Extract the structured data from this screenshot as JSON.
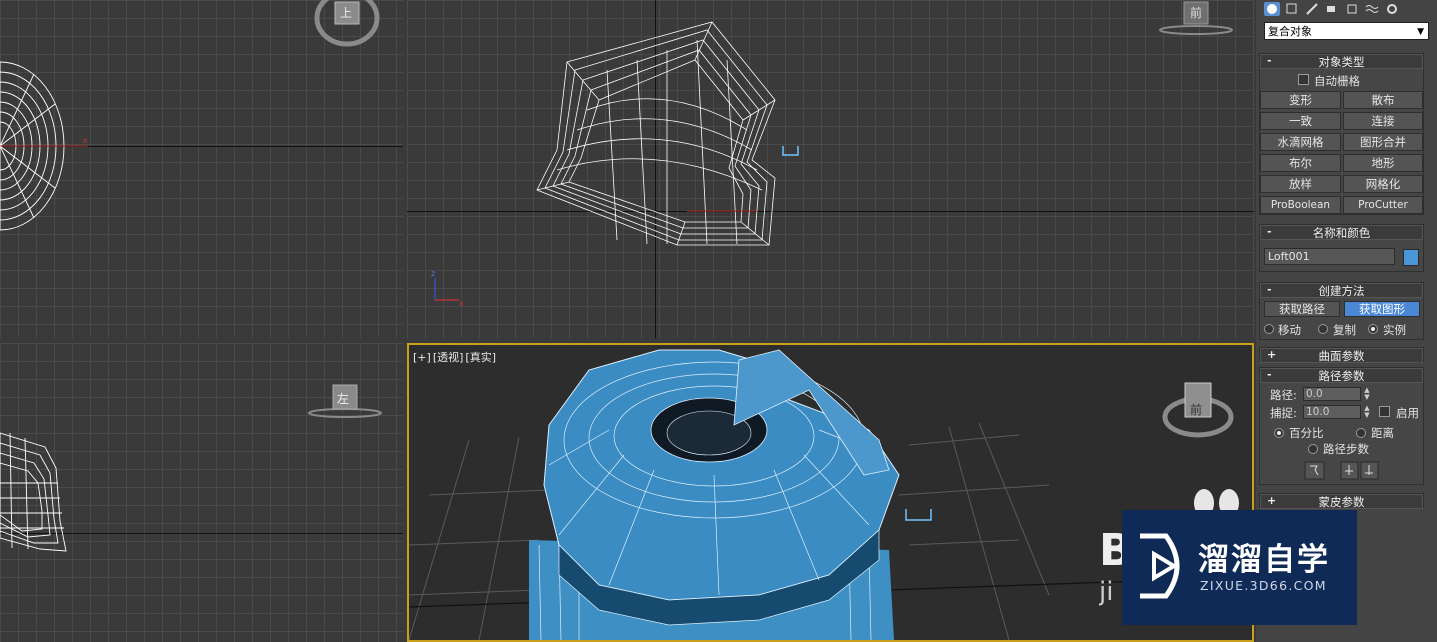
{
  "viewports": {
    "top": {
      "cube_label": "上"
    },
    "front": {
      "cube_label": "前"
    },
    "left": {
      "cube_label": "左"
    },
    "perspective": {
      "label_parts": [
        "[+]",
        "[透视]",
        "[真实]"
      ],
      "cube_label": "前"
    }
  },
  "command_panel": {
    "category_dropdown": "复合对象",
    "object_type": {
      "title": "对象类型",
      "autogrid_label": "自动栅格",
      "buttons": [
        "变形",
        "散布",
        "一致",
        "连接",
        "水滴网格",
        "图形合并",
        "布尔",
        "地形",
        "放样",
        "网格化",
        "ProBoolean",
        "ProCutter"
      ]
    },
    "name_and_color": {
      "title": "名称和颜色",
      "name_value": "Loft001",
      "color": "#4a96d6"
    },
    "creation_method": {
      "title": "创建方法",
      "get_path": "获取路径",
      "get_shape": "获取图形",
      "radios": [
        "移动",
        "复制",
        "实例"
      ],
      "selected_radio": "实例"
    },
    "surface_params": {
      "title": "曲面参数"
    },
    "path_params": {
      "title": "路径参数",
      "path_label": "路径:",
      "path_value": "0.0",
      "snap_label": "捕捉:",
      "snap_value": "10.0",
      "enable_label": "启用",
      "percent_label": "百分比",
      "distance_label": "距离",
      "steps_label": "路径步数",
      "selected_mode": "百分比"
    },
    "skin_params": {
      "title": "蒙皮参数"
    }
  },
  "watermark": {
    "cn": "溜溜自学",
    "en": "ZIXUE.3D66.COM"
  },
  "colors": {
    "accent": "#4a87d4",
    "active_viewport_border": "#c8a019",
    "mesh_blue": "#3d8fc4"
  }
}
